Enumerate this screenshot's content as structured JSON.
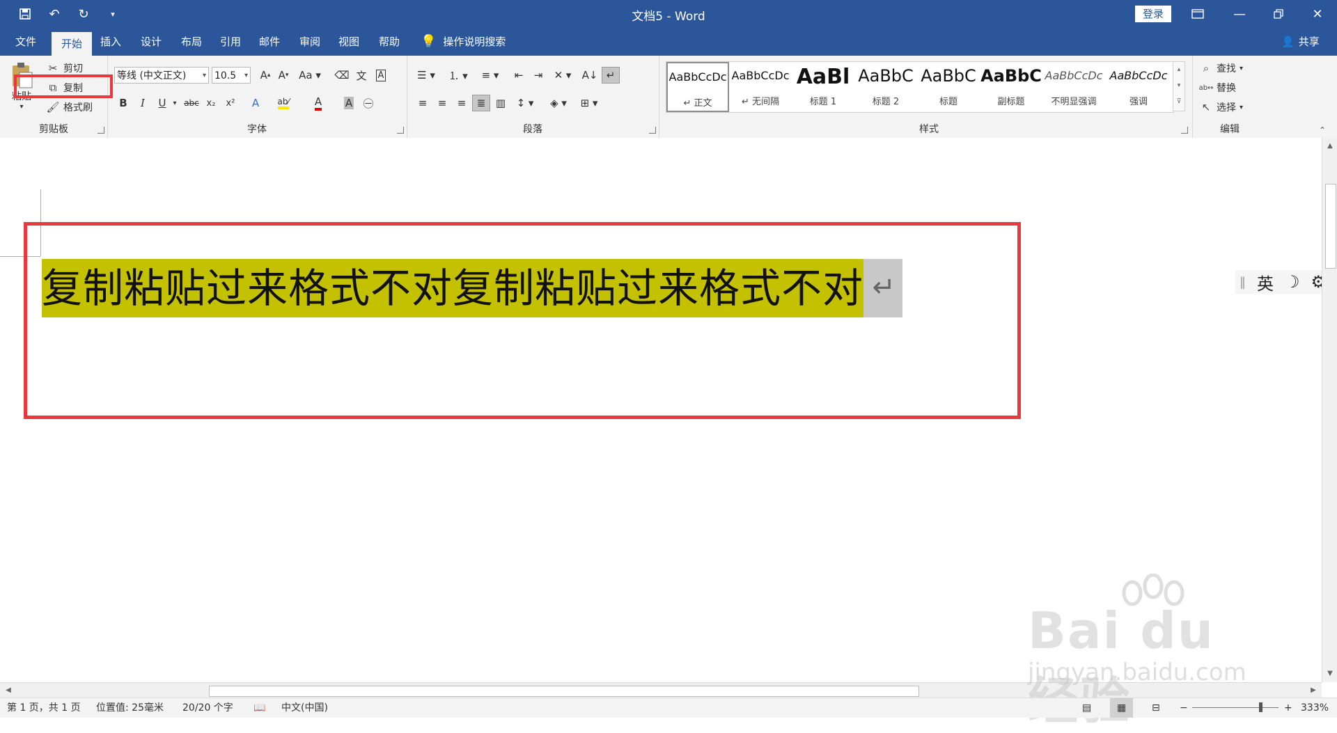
{
  "window": {
    "title": "文档5  -  Word",
    "login_label": "登录"
  },
  "tabs": [
    {
      "label": "文件"
    },
    {
      "label": "开始"
    },
    {
      "label": "插入"
    },
    {
      "label": "设计"
    },
    {
      "label": "布局"
    },
    {
      "label": "引用"
    },
    {
      "label": "邮件"
    },
    {
      "label": "审阅"
    },
    {
      "label": "视图"
    },
    {
      "label": "帮助"
    }
  ],
  "tell_me": "操作说明搜索",
  "share": "共享",
  "clipboard": {
    "paste": "粘贴",
    "cut": "剪切",
    "copy": "复制",
    "format_painter": "格式刷",
    "group_label": "剪贴板"
  },
  "font": {
    "name": "等线 (中文正文)",
    "size": "10.5",
    "group_label": "字体"
  },
  "paragraph": {
    "group_label": "段落"
  },
  "styles": {
    "group_label": "样式",
    "items": [
      {
        "preview": "AaBbCcDc",
        "name": "↵ 正文"
      },
      {
        "preview": "AaBbCcDc",
        "name": "↵ 无间隔"
      },
      {
        "preview": "AaBl",
        "name": "标题 1"
      },
      {
        "preview": "AaBbC",
        "name": "标题 2"
      },
      {
        "preview": "AaBbC",
        "name": "标题"
      },
      {
        "preview": "AaBbC",
        "name": "副标题"
      },
      {
        "preview": "AaBbCcDc",
        "name": "不明显强调"
      },
      {
        "preview": "AaBbCcDc",
        "name": "强调"
      }
    ]
  },
  "editing": {
    "find": "查找",
    "replace": "替换",
    "select": "选择",
    "group_label": "编辑"
  },
  "document": {
    "text": "复制粘贴过来格式不对复制粘贴过来格式不对",
    "highlight_color": "#c4c200"
  },
  "ime": {
    "lang": "英"
  },
  "status": {
    "page": "第 1 页，共 1 页",
    "position": "位置值: 25毫米",
    "words": "20/20 个字",
    "language": "中文(中国)",
    "zoom": "333%"
  },
  "watermark": {
    "brand": "Bai du 经验",
    "url": "jingyan.baidu.com"
  },
  "colors": {
    "ribbon_blue": "#2b579a",
    "annotation_red": "#e8393e"
  }
}
